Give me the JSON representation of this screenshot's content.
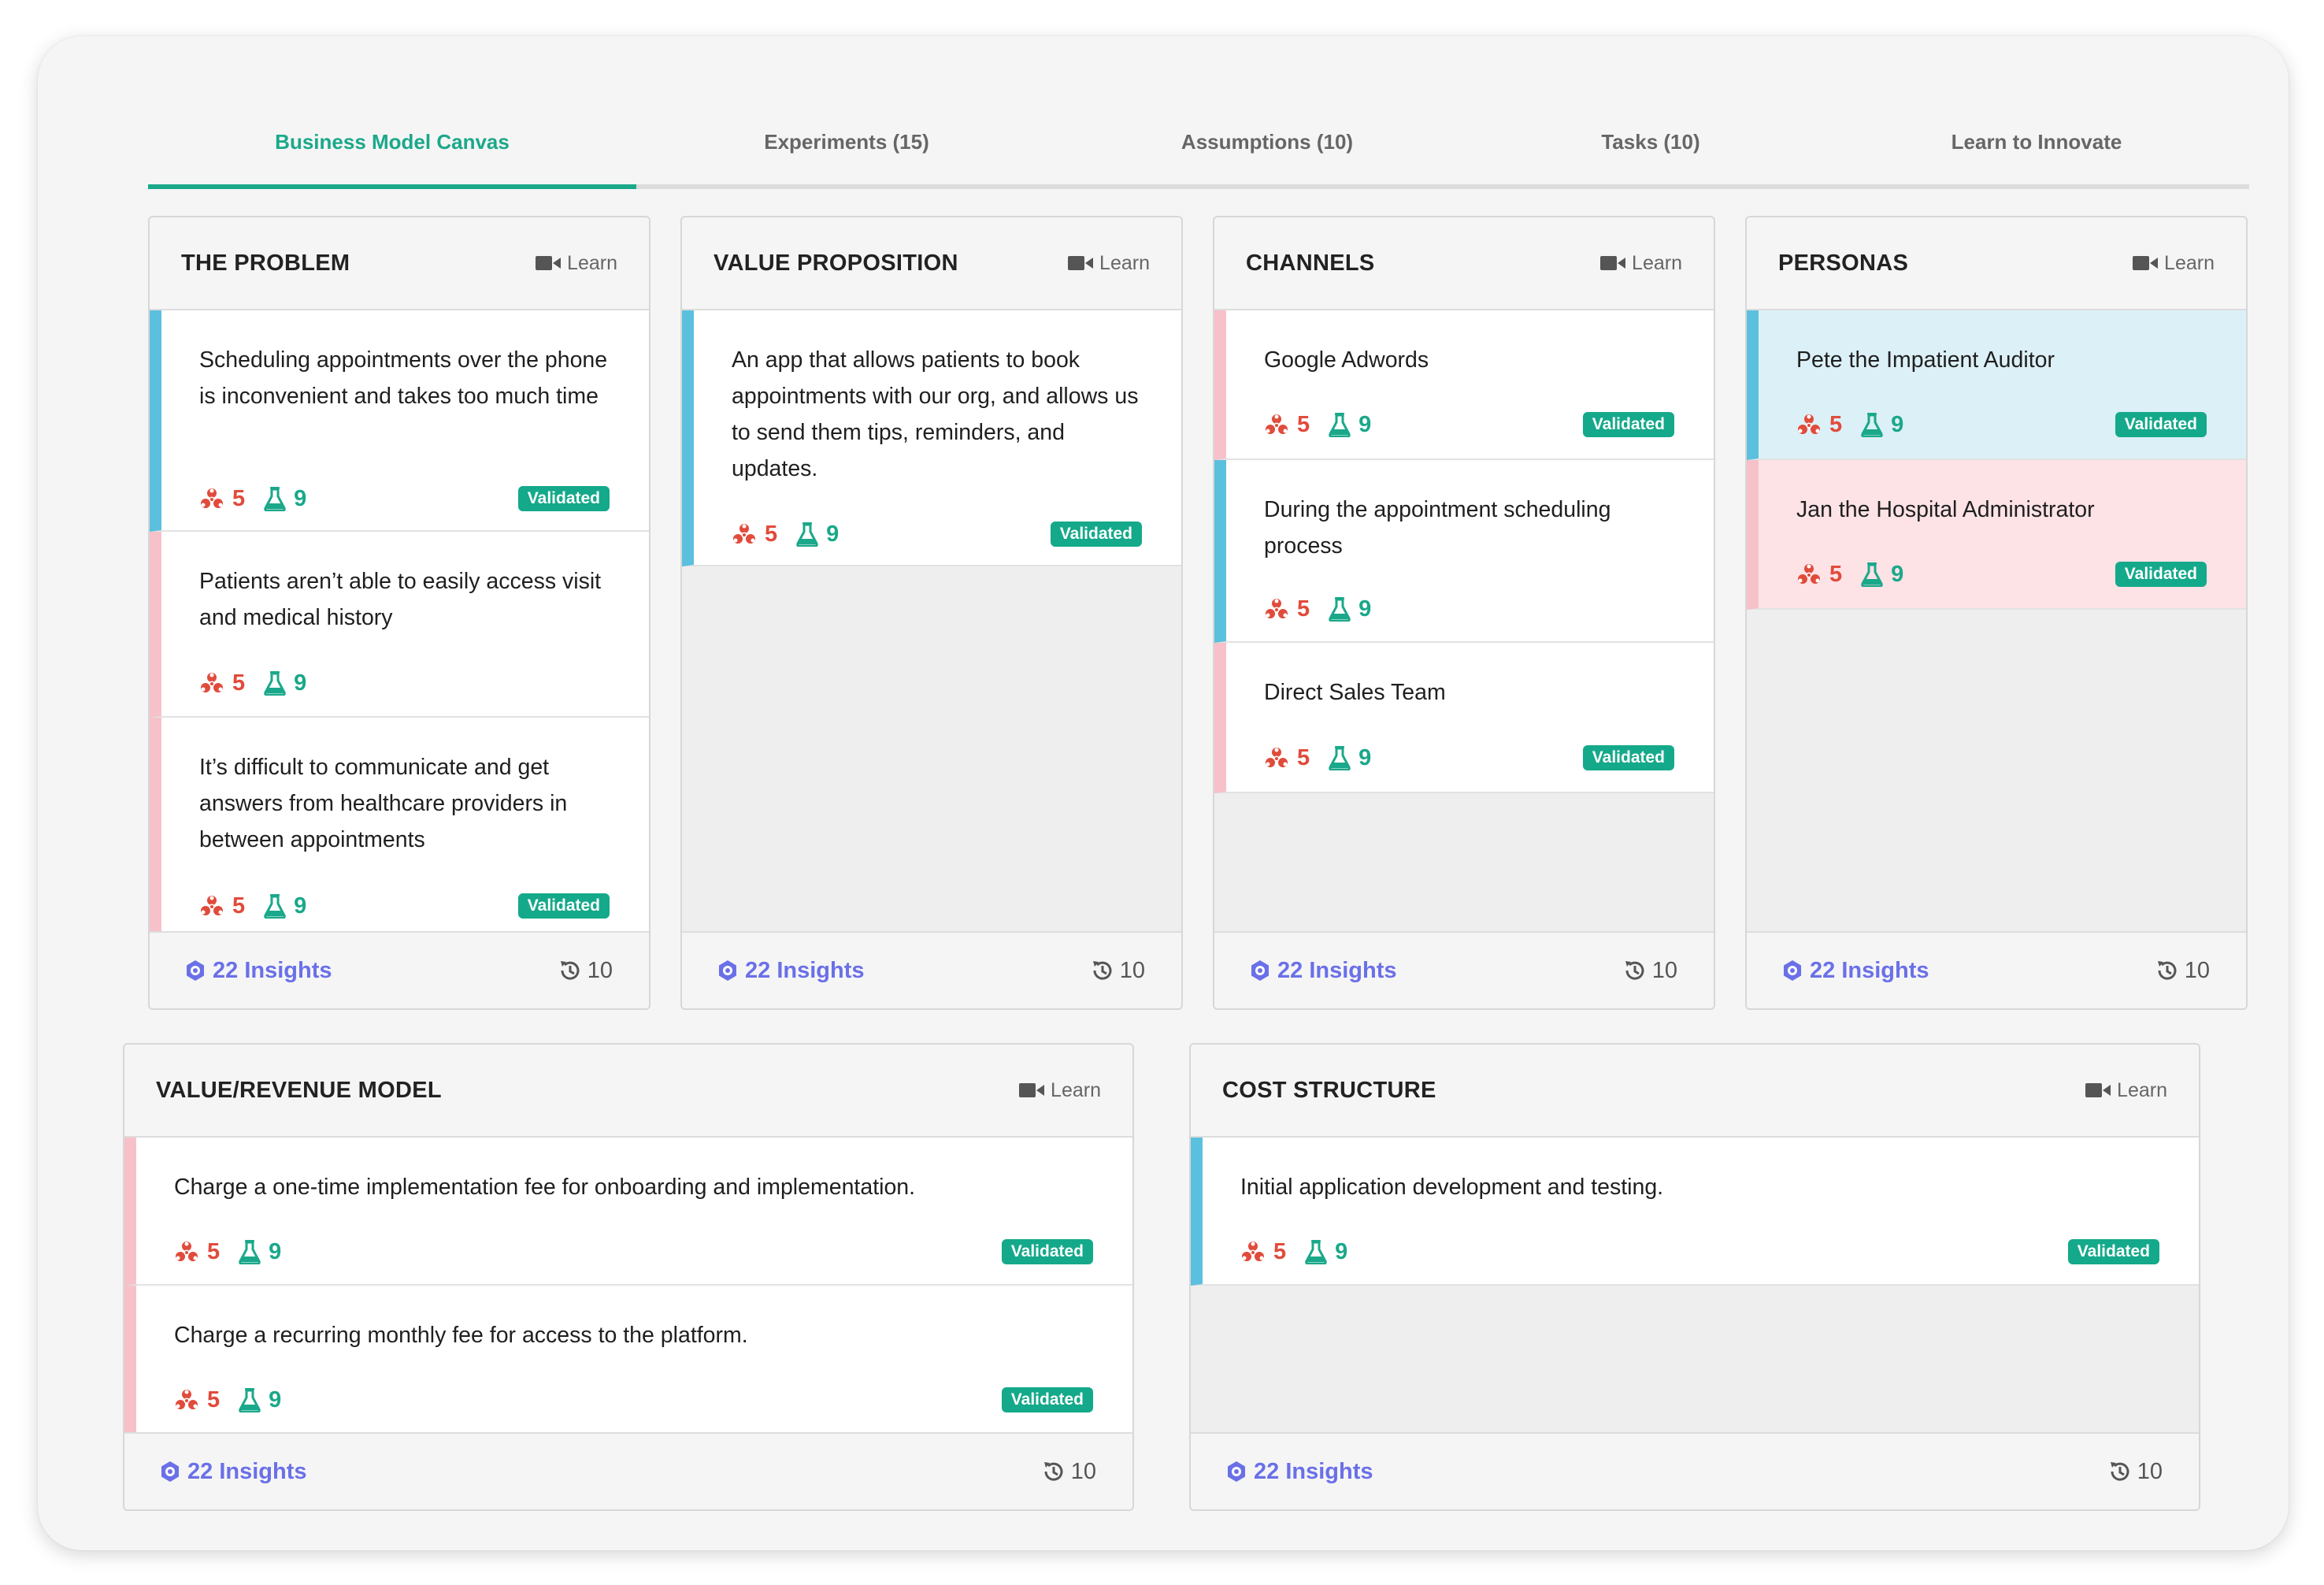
{
  "tabs": [
    {
      "label": "Business Model Canvas",
      "active": true
    },
    {
      "label": "Experiments (15)",
      "active": false
    },
    {
      "label": "Assumptions (10)",
      "active": false
    },
    {
      "label": "Tasks (10)",
      "active": false
    },
    {
      "label": "Learn to Innovate",
      "active": false
    }
  ],
  "common": {
    "learn_label": "Learn",
    "insights_label": "22 Insights",
    "history_count": "10",
    "badge_label": "Validated",
    "bio_count": "5",
    "flask_count": "9"
  },
  "colors": {
    "accent_green": "#1aa88a",
    "alert_red": "#e14b3b",
    "insights_purple": "#6a70e8",
    "stripe_blue": "#5bc0de",
    "stripe_pink": "#f7c1c9",
    "card_bg_blue": "#dcf0f7",
    "card_bg_pink": "#fde2e6"
  },
  "icons": {
    "learn": "video-camera-icon",
    "risk": "biohazard-icon",
    "experiments": "flask-icon",
    "insights": "gear-icon",
    "history": "history-icon"
  },
  "panels": {
    "problem": {
      "title": "THE PROBLEM",
      "cards": [
        {
          "text": "Scheduling appointments over the phone is inconvenient and takes too much time",
          "validated": true,
          "stripe": "blue"
        },
        {
          "text": "Patients aren’t able to easily access visit and medical history",
          "validated": false,
          "stripe": "pink"
        },
        {
          "text": "It’s difficult to communicate and get answers from healthcare providers in between appointments",
          "validated": true,
          "stripe": "pink"
        }
      ]
    },
    "value_prop": {
      "title": "VALUE PROPOSITION",
      "cards": [
        {
          "text": "An app that allows patients to book appointments with our org, and allows us to send them tips, reminders, and updates.",
          "validated": true,
          "stripe": "blue"
        }
      ]
    },
    "channels": {
      "title": "CHANNELS",
      "cards": [
        {
          "text": "Google Adwords",
          "validated": true,
          "stripe": "pink"
        },
        {
          "text": "During the appointment scheduling process",
          "validated": false,
          "stripe": "blue"
        },
        {
          "text": "Direct Sales Team",
          "validated": true,
          "stripe": "pink"
        }
      ]
    },
    "personas": {
      "title": "PERSONAS",
      "cards": [
        {
          "text": "Pete the Impatient Auditor",
          "validated": true,
          "stripe": "blue"
        },
        {
          "text": "Jan the Hospital Administrator",
          "validated": true,
          "stripe": "pink"
        }
      ]
    },
    "revenue": {
      "title": "VALUE/REVENUE MODEL",
      "cards": [
        {
          "text": "Charge a one-time implementation fee for onboarding and implementation.",
          "validated": true,
          "stripe": "pink"
        },
        {
          "text": "Charge a recurring monthly fee for access to the platform.",
          "validated": true,
          "stripe": "pink"
        }
      ]
    },
    "cost": {
      "title": "COST STRUCTURE",
      "cards": [
        {
          "text": "Initial application development and testing.",
          "validated": true,
          "stripe": "blue"
        }
      ]
    }
  }
}
